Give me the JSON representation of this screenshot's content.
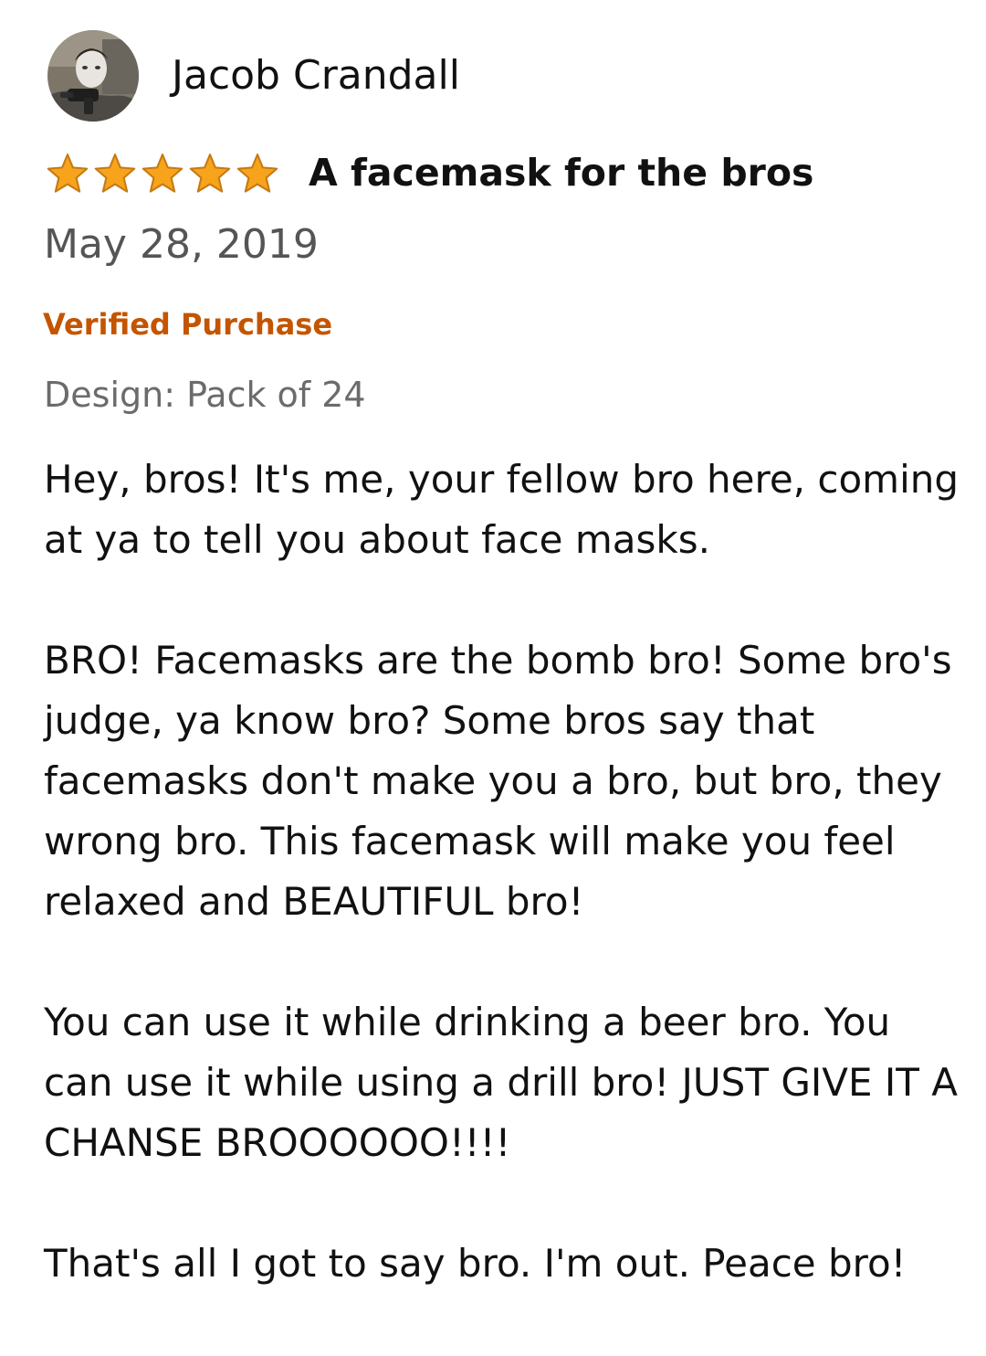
{
  "review": {
    "reviewer": {
      "name": "Jacob Crandall",
      "avatar_icon": "profile-photo"
    },
    "rating": {
      "value": 5,
      "max": 5,
      "star_color": "#f7a41c",
      "star_outline": "#c67a12"
    },
    "title": "A facemask for the bros",
    "date": "May 28, 2019",
    "verified_label": "Verified Purchase",
    "verified_color": "#c45500",
    "variant": "Design: Pack of 24",
    "body": [
      "Hey, bros! It's me, your fellow bro here, coming at ya to tell you about face masks.",
      "BRO! Facemasks are the bomb bro! Some bro's judge, ya know bro? Some bros say that facemasks don't make you a bro, but bro, they wrong bro. This facemask will make you feel relaxed and BEAUTIFUL bro!",
      "You can use it while drinking a beer bro. You can use it while using a drill bro! JUST GIVE IT A CHANSE BROOOOOO!!!!",
      "That's all I got to say bro. I'm out. Peace bro!"
    ]
  }
}
